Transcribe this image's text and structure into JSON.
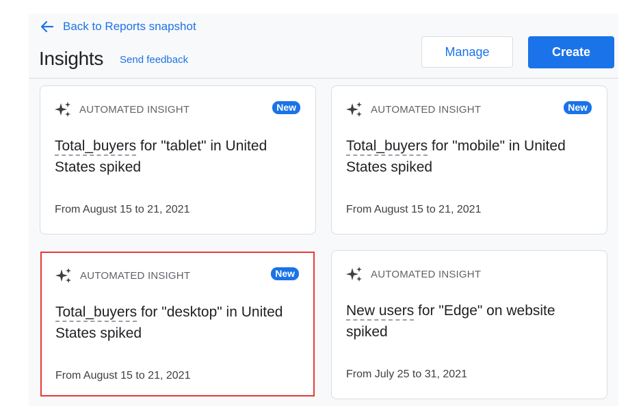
{
  "header": {
    "back_label": "Back to Reports snapshot",
    "title": "Insights",
    "feedback_label": "Send feedback",
    "manage_label": "Manage",
    "create_label": "Create"
  },
  "colors": {
    "accent": "#1a73e8",
    "selection_outline": "#e53935"
  },
  "icons": {
    "back": "arrow-left-icon",
    "insight": "sparkle-icon"
  },
  "cards": [
    {
      "kicker": "AUTOMATED INSIGHT",
      "badge": "New",
      "metric": "Total_buyers",
      "title_rest": " for \"tablet\" in United States spiked",
      "date": "From August 15 to 21, 2021"
    },
    {
      "kicker": "AUTOMATED INSIGHT",
      "badge": "New",
      "metric": "Total_buyers",
      "title_rest": " for \"mobile\" in United States spiked",
      "date": "From August 15 to 21, 2021"
    },
    {
      "kicker": "AUTOMATED INSIGHT",
      "badge": "New",
      "metric": "Total_buyers",
      "title_rest": " for \"desktop\" in United States spiked",
      "date": "From August 15 to 21, 2021",
      "selected": true
    },
    {
      "kicker": "AUTOMATED INSIGHT",
      "badge": "",
      "metric": "New users",
      "title_rest": " for \"Edge\" on website spiked",
      "date": "From July 25 to 31, 2021"
    }
  ]
}
